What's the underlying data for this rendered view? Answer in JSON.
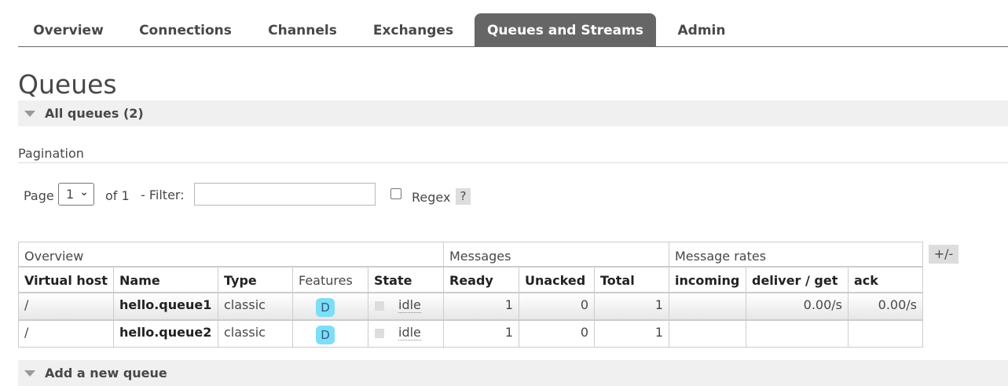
{
  "nav": {
    "tabs": [
      {
        "label": "Overview",
        "active": false
      },
      {
        "label": "Connections",
        "active": false
      },
      {
        "label": "Channels",
        "active": false
      },
      {
        "label": "Exchanges",
        "active": false
      },
      {
        "label": "Queues and Streams",
        "active": true
      },
      {
        "label": "Admin",
        "active": false
      }
    ]
  },
  "page": {
    "title": "Queues"
  },
  "all_queues": {
    "label": "All queues (2)"
  },
  "pagination": {
    "title": "Pagination",
    "page_label": "Page",
    "page_value": "1",
    "of_label": "of 1",
    "filter_label": "- Filter:",
    "filter_value": "",
    "regex_label": "Regex",
    "regex_checked": false,
    "help_label": "?"
  },
  "table": {
    "groups": [
      "Overview",
      "Messages",
      "Message rates"
    ],
    "columns_toggle": "+/-",
    "headers": [
      "Virtual host",
      "Name",
      "Type",
      "Features",
      "State",
      "Ready",
      "Unacked",
      "Total",
      "incoming",
      "deliver / get",
      "ack"
    ],
    "rows": [
      {
        "vhost": "/",
        "name": "hello.queue1",
        "type": "classic",
        "feature": "D",
        "state": "idle",
        "ready": "1",
        "unacked": "0",
        "total": "1",
        "incoming": "",
        "deliver_get": "0.00/s",
        "ack": "0.00/s"
      },
      {
        "vhost": "/",
        "name": "hello.queue2",
        "type": "classic",
        "feature": "D",
        "state": "idle",
        "ready": "1",
        "unacked": "0",
        "total": "1",
        "incoming": "",
        "deliver_get": "",
        "ack": ""
      }
    ]
  },
  "add_queue": {
    "label": "Add a new queue"
  },
  "colors": {
    "active_tab_bg": "#666666",
    "feature_badge_bg": "#7ddef7",
    "section_bg": "#f0f0f0"
  }
}
